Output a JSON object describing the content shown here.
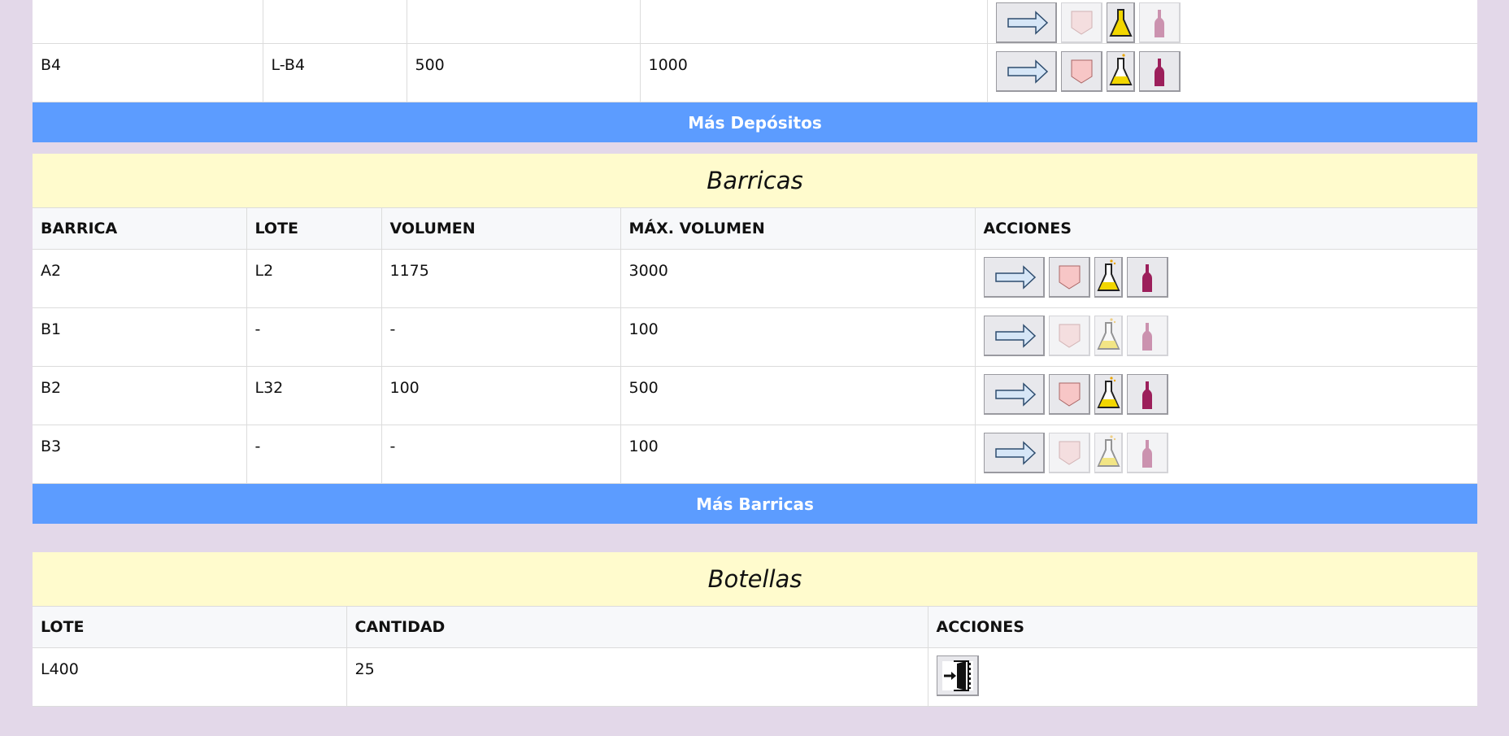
{
  "depositos": {
    "partial_row": {
      "label": "",
      "lot": "",
      "volume": "",
      "max": ""
    },
    "rows": [
      {
        "name": "B4",
        "lot": "L-B4",
        "volume": "500",
        "max": "1000",
        "enabled": true
      }
    ],
    "more_button": "Más Depósitos"
  },
  "barricas": {
    "title": "Barricas",
    "headers": [
      "BARRICA",
      "LOTE",
      "VOLUMEN",
      "MÁX. VOLUMEN",
      "ACCIONES"
    ],
    "rows": [
      {
        "name": "A2",
        "lot": "L2",
        "volume": "1175",
        "max": "3000",
        "enabled": true
      },
      {
        "name": "B1",
        "lot": "-",
        "volume": "-",
        "max": "100",
        "enabled": false
      },
      {
        "name": "B2",
        "lot": "L32",
        "volume": "100",
        "max": "500",
        "enabled": true
      },
      {
        "name": "B3",
        "lot": "-",
        "volume": "-",
        "max": "100",
        "enabled": false
      }
    ],
    "more_button": "Más Barricas"
  },
  "botellas": {
    "title": "Botellas",
    "headers": [
      "LOTE",
      "CANTIDAD",
      "ACCIONES"
    ],
    "rows": [
      {
        "lot": "L400",
        "quantity": "25"
      }
    ]
  },
  "icons": {
    "transfer": "arrow-right-icon",
    "empty": "shield-icon",
    "analysis": "flask-icon",
    "bottle": "wine-bottle-icon",
    "exit": "door-exit-icon"
  },
  "colors": {
    "background": "#e3d8e9",
    "section_header": "#fffbcd",
    "more_button": "#5c9cff",
    "wine": "#9c1f5b",
    "flask_liquid": "#f2d600",
    "shield": "#f7c6c6"
  }
}
